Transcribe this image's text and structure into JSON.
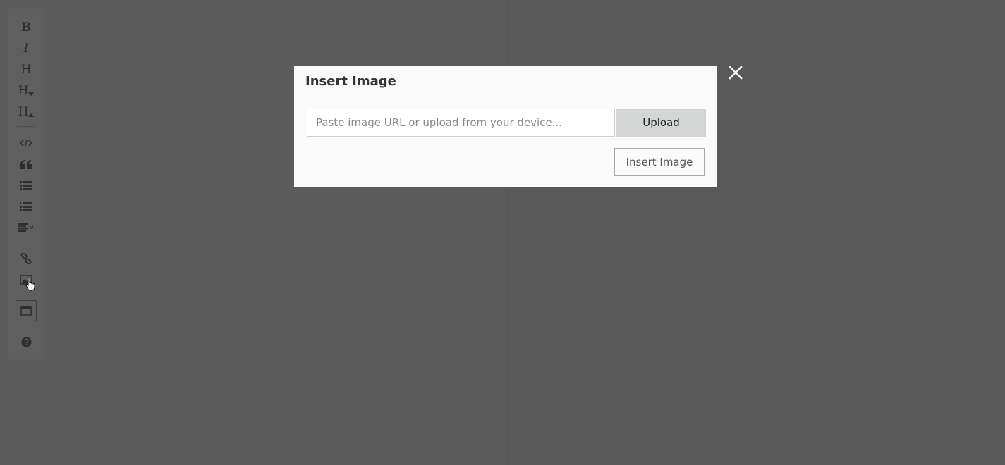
{
  "toolbar": {
    "bold": "B",
    "italic": "I",
    "heading": "H",
    "heading_smaller": "H",
    "heading_bigger": "H",
    "icons": [
      "bold-icon",
      "italic-icon",
      "heading-icon",
      "heading-smaller-icon",
      "heading-bigger-icon",
      "code-icon",
      "quote-icon",
      "unordered-list-icon",
      "ordered-list-icon",
      "align-dropdown-icon",
      "link-icon",
      "image-icon",
      "preview-icon",
      "help-icon"
    ]
  },
  "modal": {
    "title": "Insert Image",
    "url_placeholder": "Paste image URL or upload from your device...",
    "url_value": "",
    "upload_label": "Upload",
    "insert_label": "Insert Image"
  },
  "colors": {
    "overlay_left": "#5c5c5c",
    "overlay_right": "#595959",
    "modal_bg": "#fafafa",
    "upload_bg": "#d4d6d6"
  }
}
